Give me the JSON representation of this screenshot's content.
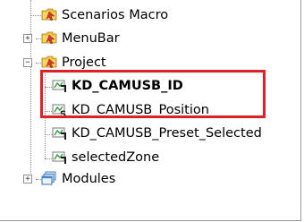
{
  "tree": {
    "nodes": [
      {
        "label": "Scenarios Macro",
        "icon": "scenario-folder-icon",
        "expander": ""
      },
      {
        "label": "MenuBar",
        "icon": "scenario-folder-icon",
        "expander": "+"
      },
      {
        "label": "Project",
        "icon": "scenario-folder-icon",
        "expander": "−"
      },
      {
        "label": "KD_CAMUSB_ID",
        "icon": "variable-tag-icon"
      },
      {
        "label": "KD_CAMUSB_Position",
        "icon": "variable-position-icon"
      },
      {
        "label": "KD_CAMUSB_Preset_Selected",
        "icon": "variable-tag-icon"
      },
      {
        "label": "selectedZone",
        "icon": "variable-tag-icon"
      },
      {
        "label": "Modules",
        "icon": "modules-icon",
        "expander": "+"
      }
    ]
  },
  "highlight_color": "#e02028"
}
